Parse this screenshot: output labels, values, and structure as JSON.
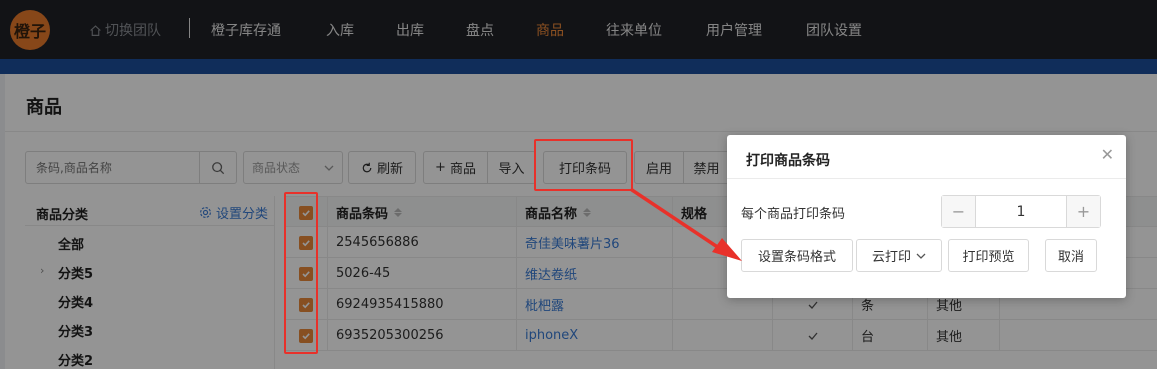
{
  "nav": {
    "logo_text": "橙子",
    "switch_team": "切换团队",
    "items": [
      "橙子库存通",
      "入库",
      "出库",
      "盘点",
      "商品",
      "往来单位",
      "用户管理",
      "团队设置"
    ],
    "active_index": 4,
    "active_color": "#f08a3a"
  },
  "page": {
    "title": "商品"
  },
  "toolbar": {
    "search_placeholder": "条码,商品名称",
    "status_placeholder": "商品状态",
    "refresh": "刷新",
    "add_product": "商品",
    "import": "导入",
    "print_barcode": "打印条码",
    "enable": "启用",
    "disable": "禁用"
  },
  "sidebar": {
    "title": "商品分类",
    "settings": "设置分类",
    "categories": [
      "全部",
      "分类5",
      "分类4",
      "分类3",
      "分类2"
    ]
  },
  "table": {
    "headers": {
      "barcode": "商品条码",
      "name": "商品名称",
      "spec": "规格"
    },
    "rows": [
      {
        "barcode": "2545656886",
        "name": "奇佳美味薯片36",
        "unit": "",
        "category": ""
      },
      {
        "barcode": "5026-45",
        "name": "维达卷纸",
        "unit": "",
        "category": ""
      },
      {
        "barcode": "6924935415880",
        "name": "枇杷露",
        "unit": "条",
        "category": "其他"
      },
      {
        "barcode": "6935205300256",
        "name": "iphoneX",
        "unit": "台",
        "category": "其他"
      }
    ]
  },
  "dialog": {
    "title": "打印商品条码",
    "label": "每个商品打印条码",
    "quantity": "1",
    "btn_format": "设置条码格式",
    "btn_cloud": "云打印",
    "btn_preview": "打印预览",
    "btn_cancel": "取消"
  },
  "colors": {
    "accent": "#e8883a",
    "link": "#3a7bd5",
    "highlight": "#e8312a"
  }
}
